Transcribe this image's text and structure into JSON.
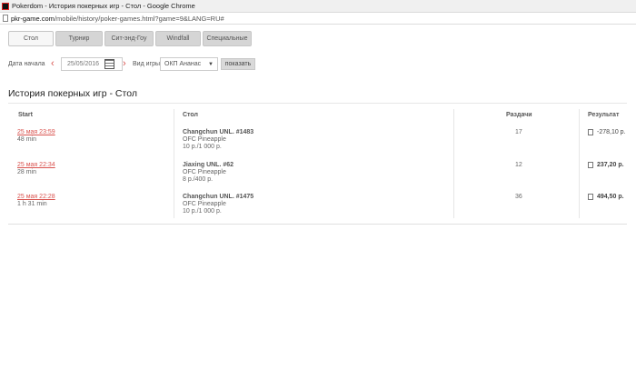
{
  "window": {
    "title": "Pokerdom - История покерных игр - Стол - Google Chrome"
  },
  "address": {
    "domain": "pkr-game.com",
    "path": "/mobile/history/poker-games.html?game=9&LANG=RU#"
  },
  "tabs": [
    {
      "label": "Стол",
      "active": true
    },
    {
      "label": "Турнир",
      "active": false
    },
    {
      "label": "Сит-энд-Гоу",
      "active": false
    },
    {
      "label": "Windfall",
      "active": false
    },
    {
      "label": "Специальные",
      "active": false
    }
  ],
  "filters": {
    "start_date_label": "Дата начала",
    "start_date_value": "25/05/2016",
    "game_type_label": "Вид игры",
    "game_type_value": "ОКП Ананас",
    "show_label": "показать"
  },
  "page_title": "История покерных игр - Стол",
  "table": {
    "headers": {
      "start": "Start",
      "table": "Стол",
      "hands": "Раздачи",
      "result": "Результат"
    },
    "rows": [
      {
        "start": "25 мая 23:59",
        "duration": "48 min",
        "table_name": "Changchun UNL. #1483",
        "game": "OFC Pineapple",
        "stakes": "10 p./1 000 p.",
        "hands": "17",
        "result": "-278,10 p."
      },
      {
        "start": "25 мая 22:34",
        "duration": "28 min",
        "table_name": "Jiaxing UNL. #62",
        "game": "OFC Pineapple",
        "stakes": "8 p./400 p.",
        "hands": "12",
        "result": "237,20 p."
      },
      {
        "start": "25 мая 22:28",
        "duration": "1 h 31 min",
        "table_name": "Changchun UNL. #1475",
        "game": "OFC Pineapple",
        "stakes": "10 p./1 000 p.",
        "hands": "36",
        "result": "494,50 p."
      }
    ]
  }
}
